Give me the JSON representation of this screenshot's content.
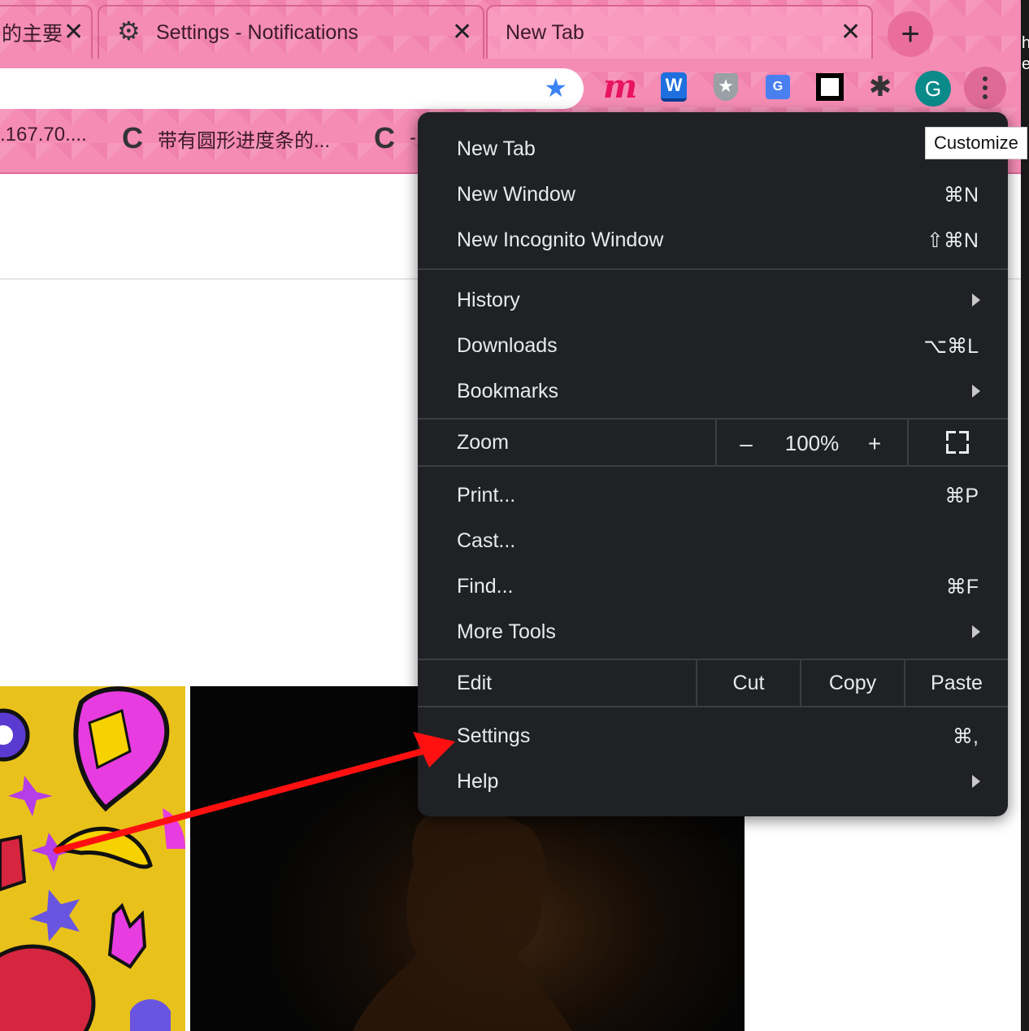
{
  "tabs": [
    {
      "title": "的主要",
      "close": "✕"
    },
    {
      "title": "Settings - Notifications",
      "close": "✕"
    },
    {
      "title": "New Tab",
      "close": "✕"
    }
  ],
  "new_tab_button": "+",
  "profile_initial": "G",
  "extensions": {
    "m": "m",
    "w": "W",
    "translate": "G"
  },
  "bookmarks": [
    {
      "icon": "C",
      "title": ".167.70...."
    },
    {
      "icon": "C",
      "title": "带有圆形进度条的..."
    },
    {
      "icon": "C",
      "title": "-"
    }
  ],
  "tooltip": "Customize",
  "edge_glyphs": "h\ne",
  "menu": {
    "new_tab": "New Tab",
    "new_window": "New Window",
    "new_window_shortcut": "⌘N",
    "new_incognito": "New Incognito Window",
    "new_incognito_shortcut": "⇧⌘N",
    "history": "History",
    "downloads": "Downloads",
    "downloads_shortcut": "⌥⌘L",
    "bookmarks": "Bookmarks",
    "zoom": "Zoom",
    "zoom_minus": "–",
    "zoom_level": "100%",
    "zoom_plus": "+",
    "print": "Print...",
    "print_shortcut": "⌘P",
    "cast": "Cast...",
    "find": "Find...",
    "find_shortcut": "⌘F",
    "more_tools": "More Tools",
    "edit": "Edit",
    "cut": "Cut",
    "copy": "Copy",
    "paste": "Paste",
    "settings": "Settings",
    "settings_shortcut": "⌘,",
    "help": "Help"
  },
  "colors": {
    "chrome_pink": "#f58cb4",
    "menu_bg": "#202124",
    "annotation_arrow": "#ff0000"
  }
}
